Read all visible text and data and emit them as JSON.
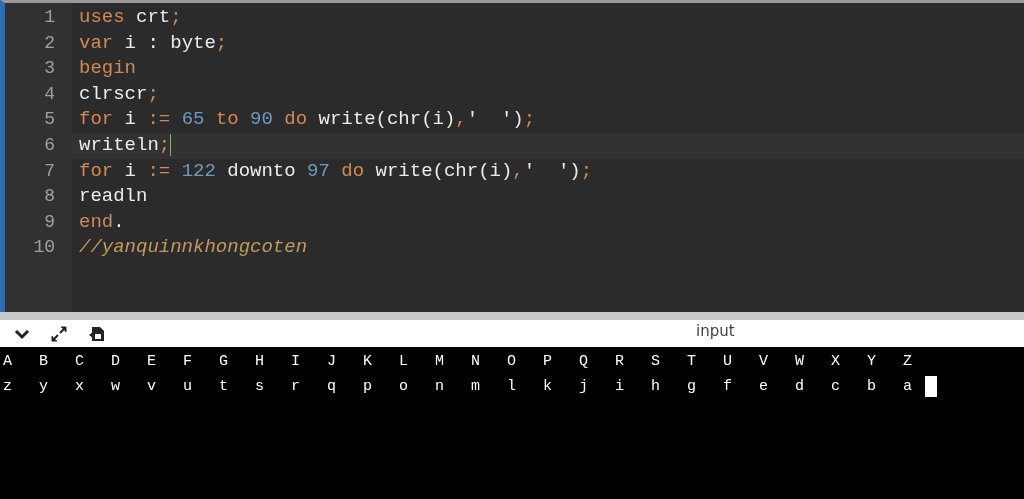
{
  "editor": {
    "lines": [
      {
        "number": "1",
        "active": false,
        "tokens": [
          {
            "kind": "keyword",
            "text": "uses"
          },
          {
            "kind": "ident",
            "text": " crt"
          },
          {
            "kind": "keyword",
            "text": ";"
          }
        ]
      },
      {
        "number": "2",
        "active": false,
        "tokens": [
          {
            "kind": "keyword",
            "text": "var"
          },
          {
            "kind": "ident",
            "text": " i : byte"
          },
          {
            "kind": "keyword",
            "text": ";"
          }
        ]
      },
      {
        "number": "3",
        "active": false,
        "tokens": [
          {
            "kind": "keyword",
            "text": "begin"
          }
        ]
      },
      {
        "number": "4",
        "active": false,
        "tokens": [
          {
            "kind": "ident",
            "text": "clrscr"
          },
          {
            "kind": "keyword",
            "text": ";"
          }
        ]
      },
      {
        "number": "5",
        "active": false,
        "tokens": [
          {
            "kind": "keyword",
            "text": "for"
          },
          {
            "kind": "ident",
            "text": " i "
          },
          {
            "kind": "keyword",
            "text": ":="
          },
          {
            "kind": "number",
            "text": " 65"
          },
          {
            "kind": "keyword",
            "text": " to"
          },
          {
            "kind": "number",
            "text": " 90"
          },
          {
            "kind": "keyword",
            "text": " do"
          },
          {
            "kind": "ident",
            "text": " write(chr(i)"
          },
          {
            "kind": "keyword",
            "text": ","
          },
          {
            "kind": "ident",
            "text": "'  ')"
          },
          {
            "kind": "keyword",
            "text": ";"
          }
        ]
      },
      {
        "number": "6",
        "active": true,
        "tokens": [
          {
            "kind": "ident",
            "text": "writeln"
          },
          {
            "kind": "keyword",
            "text": ";"
          }
        ]
      },
      {
        "number": "7",
        "active": false,
        "tokens": [
          {
            "kind": "keyword",
            "text": "for"
          },
          {
            "kind": "ident",
            "text": " i "
          },
          {
            "kind": "keyword",
            "text": ":="
          },
          {
            "kind": "number",
            "text": " 122"
          },
          {
            "kind": "ident",
            "text": " downto"
          },
          {
            "kind": "number",
            "text": " 97"
          },
          {
            "kind": "keyword",
            "text": " do"
          },
          {
            "kind": "ident",
            "text": " write(chr(i)"
          },
          {
            "kind": "keyword",
            "text": ","
          },
          {
            "kind": "ident",
            "text": "'  ')"
          },
          {
            "kind": "keyword",
            "text": ";"
          }
        ]
      },
      {
        "number": "8",
        "active": false,
        "tokens": [
          {
            "kind": "ident",
            "text": "readln"
          }
        ]
      },
      {
        "number": "9",
        "active": false,
        "tokens": [
          {
            "kind": "keyword",
            "text": "end"
          },
          {
            "kind": "ident",
            "text": "."
          }
        ]
      },
      {
        "number": "10",
        "active": false,
        "tokens": [
          {
            "kind": "comment",
            "text": "//yanquinnkhongcoten"
          }
        ]
      }
    ]
  },
  "console": {
    "title": "input",
    "output": [
      "A  B  C  D  E  F  G  H  I  J  K  L  M  N  O  P  Q  R  S  T  U  V  W  X  Y  Z",
      "z  y  x  w  v  u  t  s  r  q  p  o  n  m  l  k  j  i  h  g  f  e  d  c  b  a"
    ]
  }
}
